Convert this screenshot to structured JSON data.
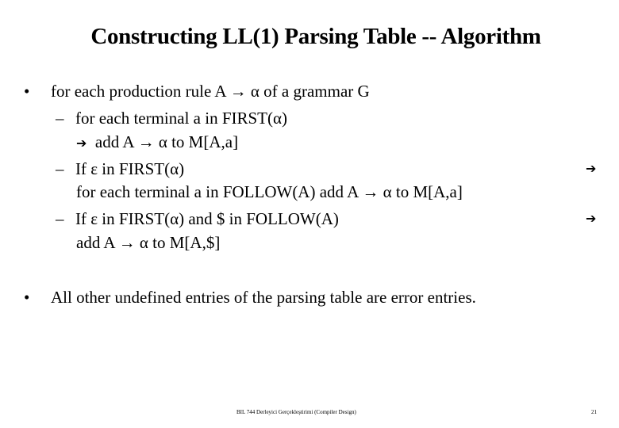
{
  "title": "Constructing LL(1) Parsing Table -- Algorithm",
  "bullets": [
    {
      "text": "for each production rule A → α  of a grammar G",
      "subitems": [
        {
          "line1": "for each terminal a in FIRST(α)",
          "line2": "add A → α  to M[A,a]"
        },
        {
          "line1": "If ε in FIRST(α)",
          "line2": "for each terminal a in FOLLOW(A)  add A → α  to M[A,a]"
        },
        {
          "line1": "If ε in FIRST(α) and $ in FOLLOW(A)",
          "line2": "add A → α  to M[A,$]"
        }
      ]
    },
    {
      "text": "All other undefined entries of the parsing table are error entries."
    }
  ],
  "symbols": {
    "bullet": "•",
    "dash": "–",
    "arrow": "➔"
  },
  "footer": {
    "course": "BIL 744 Derleyici Gerçekleştirimi (Compiler Design)",
    "page": "21"
  }
}
